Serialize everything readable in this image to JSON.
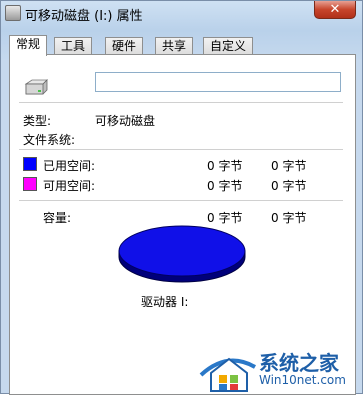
{
  "window": {
    "title": "可移动磁盘 (I:) 属性",
    "close_label": "✕"
  },
  "tabs": [
    {
      "label": "常规",
      "active": true
    },
    {
      "label": "工具",
      "active": false
    },
    {
      "label": "硬件",
      "active": false
    },
    {
      "label": "共享",
      "active": false
    },
    {
      "label": "自定义",
      "active": false
    }
  ],
  "general": {
    "name_value": "",
    "type_label": "类型:",
    "type_value": "可移动磁盘",
    "filesystem_label": "文件系统:",
    "filesystem_value": "",
    "used": {
      "label": "已用空间:",
      "bytes": "0 字节",
      "size": "0 字节",
      "color": "#0000ff"
    },
    "free": {
      "label": "可用空间:",
      "bytes": "0 字节",
      "size": "0 字节",
      "color": "#ff00ff"
    },
    "capacity": {
      "label": "容量:",
      "bytes": "0 字节",
      "size": "0 字节"
    },
    "drive_label": "驱动器 I:"
  },
  "watermark": {
    "title": "系统之家",
    "subtitle": "Win10net.com"
  }
}
